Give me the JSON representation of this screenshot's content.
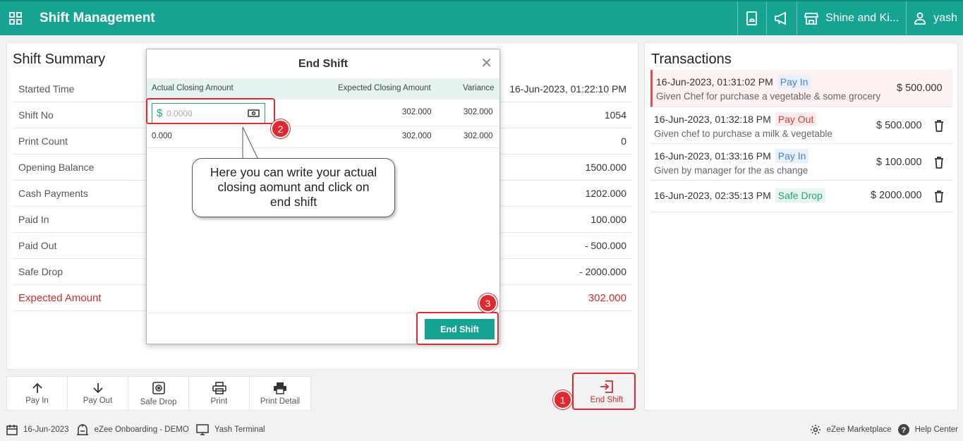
{
  "header": {
    "title": "Shift Management",
    "store_name": "Shine and Ki...",
    "user_name": "yash",
    "bg_color": "#16a391"
  },
  "summary": {
    "title": "Shift Summary",
    "rows": [
      {
        "label": "Started Time",
        "value": "16-Jun-2023, 01:22:10 PM"
      },
      {
        "label": "Shift No",
        "value": "1054"
      },
      {
        "label": "Print Count",
        "value": "0"
      },
      {
        "label": "Opening Balance",
        "value": "1500.000"
      },
      {
        "label": "Cash Payments",
        "value": "1202.000"
      },
      {
        "label": "Paid In",
        "value": "100.000"
      },
      {
        "label": "Paid Out",
        "value": "- 500.000"
      },
      {
        "label": "Safe Drop",
        "value": "- 2000.000"
      },
      {
        "label": "Expected Amount",
        "value": "302.000"
      }
    ]
  },
  "transactions": {
    "title": "Transactions",
    "items": [
      {
        "datetime": "16-Jun-2023, 01:31:02 PM",
        "type": "Pay In",
        "description": "Given Chef for purchase a vegetable & some grocery",
        "amount": "$ 500.000"
      },
      {
        "datetime": "16-Jun-2023, 01:32:18 PM",
        "type": "Pay Out",
        "description": "Given chef to purchase a milk & vegetable",
        "amount": "$ 500.000"
      },
      {
        "datetime": "16-Jun-2023, 01:33:16 PM",
        "type": "Pay In",
        "description": "Given by manager for the as change",
        "amount": "$ 100.000"
      },
      {
        "datetime": "16-Jun-2023, 02:35:13 PM",
        "type": "Safe Drop",
        "description": "",
        "amount": "$ 2000.000"
      }
    ]
  },
  "toolbar": {
    "pay_in": "Pay In",
    "pay_out": "Pay Out",
    "safe_drop": "Safe Drop",
    "print": "Print",
    "print_detail": "Print Detail",
    "end_shift": "End Shift"
  },
  "modal": {
    "title": "End Shift",
    "col_actual": "Actual Closing Amount",
    "col_expected": "Expected Closing Amount",
    "col_variance": "Variance",
    "input_currency": "$",
    "input_placeholder": "0.0000",
    "row1_expected": "302.000",
    "row1_variance": "302.000",
    "total_actual": "0.000",
    "total_expected": "302.000",
    "total_variance": "302.000",
    "end_shift_button": "End Shift"
  },
  "annotations": {
    "marker_1": "1",
    "marker_2": "2",
    "marker_3": "3",
    "callout_line1": "Here you can write your actual",
    "callout_line2": "closing aomunt and click on",
    "callout_line3": "end shift"
  },
  "footer": {
    "date": "16-Jun-2023",
    "outlet": "eZee Onboarding - DEMO",
    "terminal": "Yash Terminal",
    "marketplace": "eZee Marketplace",
    "help": "Help Center"
  }
}
